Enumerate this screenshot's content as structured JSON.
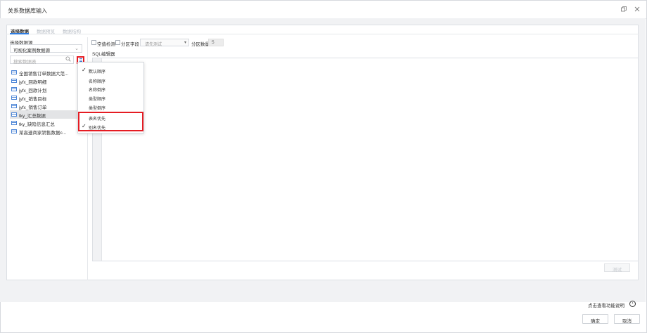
{
  "window": {
    "title": "关系数据库输入",
    "restore_icon": "restore-icon",
    "close_icon": "close-icon"
  },
  "tabs": [
    {
      "label": "选择数据",
      "active": true
    },
    {
      "label": "数据预览",
      "active": false
    },
    {
      "label": "数据结构",
      "active": false
    }
  ],
  "left_panel": {
    "datasource_label": "选择数据源",
    "datasource_value": "可视化案例数据源",
    "search_placeholder": "搜索数据表",
    "tables": [
      {
        "name": "全国销售订单数据大范...",
        "selected": false
      },
      {
        "name": "jyfx_回款明细",
        "selected": false
      },
      {
        "name": "jyfx_回款计划",
        "selected": false
      },
      {
        "name": "jyfx_销售目标",
        "selected": false
      },
      {
        "name": "jyfx_销售订单",
        "selected": false
      },
      {
        "name": "tky_汇总数据",
        "selected": true
      },
      {
        "name": "tky_缺陷信息汇总",
        "selected": false
      },
      {
        "name": "某高速商家销售数据c...",
        "selected": false
      }
    ]
  },
  "options": {
    "empty_check_label": "空值检测",
    "partition_label": "分区字段",
    "partition_placeholder": "请先测试",
    "partition_count_label": "分区数量",
    "partition_count_value": "5"
  },
  "sql_editor": {
    "label": "SQL编辑器"
  },
  "preview_button": "测试",
  "sort_menu": {
    "items": [
      {
        "label": "默认顺序",
        "checked": true
      },
      {
        "label": "名称顺序",
        "checked": false
      },
      {
        "label": "名称倒序",
        "checked": false
      },
      {
        "label": "类型顺序",
        "checked": false
      },
      {
        "label": "类型倒序",
        "checked": false
      },
      {
        "label": "表名优先",
        "checked": false
      },
      {
        "label": "别名优先",
        "checked": true
      }
    ]
  },
  "footer": {
    "help_link": "点击查看功能说明",
    "confirm": "确定",
    "cancel": "取消"
  },
  "colors": {
    "accent": "#2f7de1",
    "highlight": "#e51c23",
    "selected_row": "#e3e4e6"
  }
}
